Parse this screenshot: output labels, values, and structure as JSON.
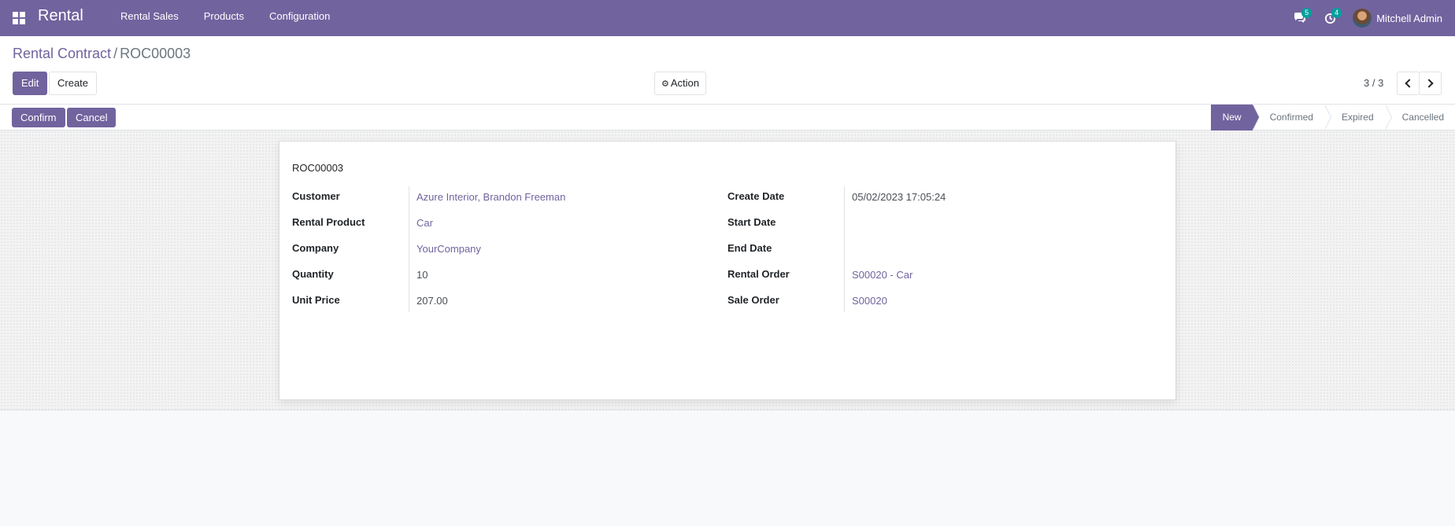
{
  "navbar": {
    "app_title": "Rental",
    "menu": [
      "Rental Sales",
      "Products",
      "Configuration"
    ],
    "messages_count": "5",
    "activities_count": "4",
    "user_name": "Mitchell Admin",
    "color": "#71639e"
  },
  "breadcrumb": {
    "parent": "Rental Contract",
    "separator": "/",
    "current": "ROC00003"
  },
  "toolbar": {
    "edit_label": "Edit",
    "create_label": "Create",
    "action_label": "Action"
  },
  "pager": {
    "value": "3 / 3"
  },
  "statusbar": {
    "confirm_label": "Confirm",
    "cancel_label": "Cancel",
    "stages": [
      "New",
      "Confirmed",
      "Expired",
      "Cancelled"
    ],
    "active_stage": "New"
  },
  "record": {
    "name": "ROC00003",
    "left_fields": [
      {
        "label": "Customer",
        "value": "Azure Interior, Brandon Freeman"
      },
      {
        "label": "Rental Product",
        "value": "Car"
      },
      {
        "label": "Company",
        "value": "YourCompany"
      },
      {
        "label": "Quantity",
        "value": "10"
      },
      {
        "label": "Unit Price",
        "value": "207.00"
      }
    ],
    "right_fields": [
      {
        "label": "Create Date",
        "value": "05/02/2023 17:05:24"
      },
      {
        "label": "Start Date",
        "value": ""
      },
      {
        "label": "End Date",
        "value": ""
      },
      {
        "label": "Rental Order",
        "value": "S00020 - Car"
      },
      {
        "label": "Sale Order",
        "value": "S00020"
      }
    ]
  },
  "icons": {
    "apps": "apps-grid-icon",
    "messages": "chat-bubbles-icon",
    "activities": "clock-icon",
    "action": "gear-icon",
    "prev": "chevron-left-icon",
    "next": "chevron-right-icon"
  }
}
